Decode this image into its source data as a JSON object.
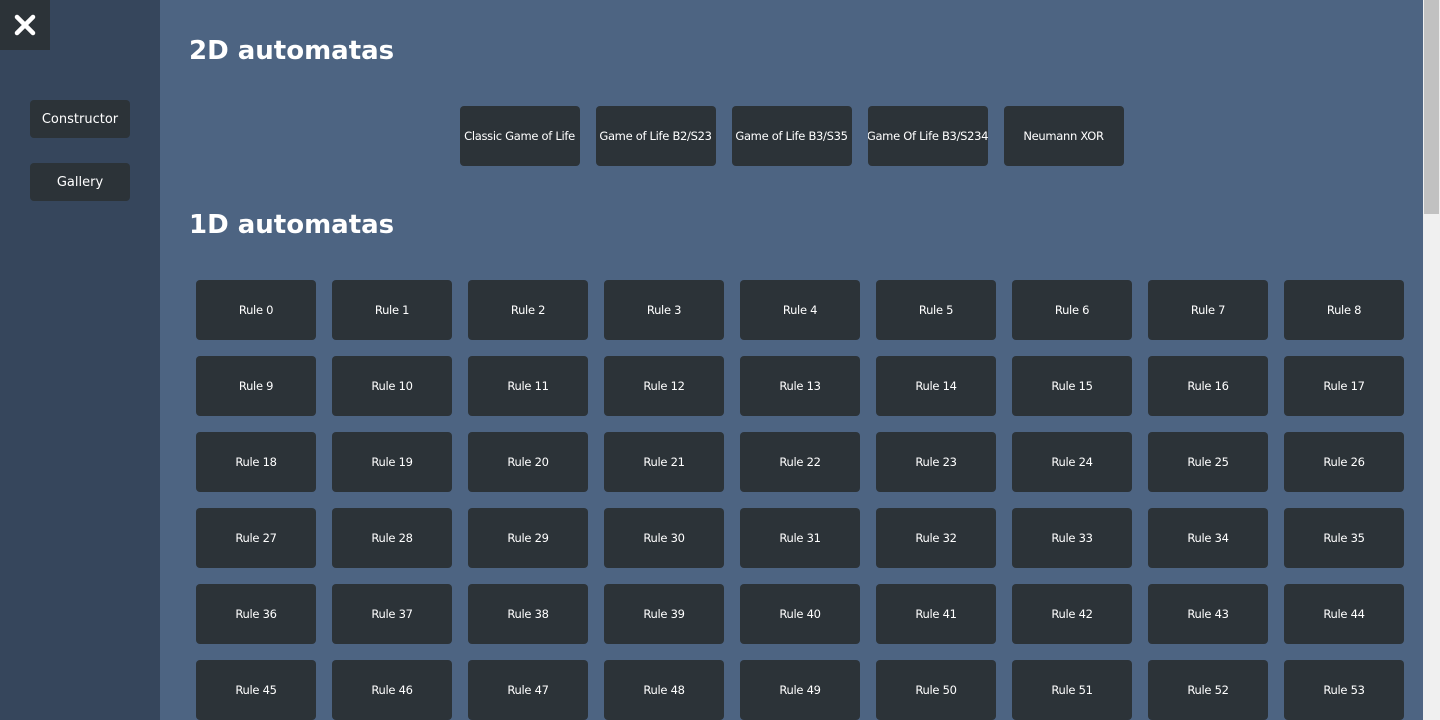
{
  "sidebar": {
    "close_icon": "close-icon",
    "buttons": [
      {
        "label": "Constructor"
      },
      {
        "label": "Gallery"
      }
    ]
  },
  "main": {
    "section_2d": {
      "title": "2D automatas",
      "items": [
        "Classic Game of Life",
        "Game of Life B2/S23",
        "Game of Life B3/S35",
        "Game Of Life B3/S234",
        "Neumann XOR"
      ]
    },
    "section_1d": {
      "title": "1D automatas",
      "items": [
        "Rule 0",
        "Rule 1",
        "Rule 2",
        "Rule 3",
        "Rule 4",
        "Rule 5",
        "Rule 6",
        "Rule 7",
        "Rule 8",
        "Rule 9",
        "Rule 10",
        "Rule 11",
        "Rule 12",
        "Rule 13",
        "Rule 14",
        "Rule 15",
        "Rule 16",
        "Rule 17",
        "Rule 18",
        "Rule 19",
        "Rule 20",
        "Rule 21",
        "Rule 22",
        "Rule 23",
        "Rule 24",
        "Rule 25",
        "Rule 26",
        "Rule 27",
        "Rule 28",
        "Rule 29",
        "Rule 30",
        "Rule 31",
        "Rule 32",
        "Rule 33",
        "Rule 34",
        "Rule 35",
        "Rule 36",
        "Rule 37",
        "Rule 38",
        "Rule 39",
        "Rule 40",
        "Rule 41",
        "Rule 42",
        "Rule 43",
        "Rule 44",
        "Rule 45",
        "Rule 46",
        "Rule 47",
        "Rule 48",
        "Rule 49",
        "Rule 50",
        "Rule 51",
        "Rule 52",
        "Rule 53"
      ]
    }
  },
  "colors": {
    "main_bg": "#4d6482",
    "sidebar_bg": "#36465c",
    "tile_bg": "#2c3338",
    "text": "#ffffff"
  }
}
